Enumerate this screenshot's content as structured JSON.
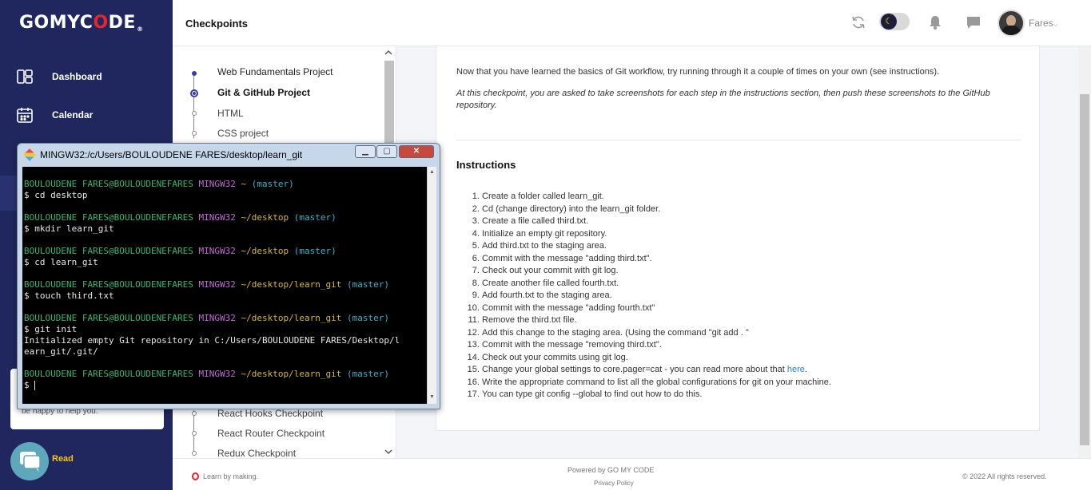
{
  "brand": {
    "logo_prefix": "GOMYC",
    "logo_o": "O",
    "logo_suffix": "DE",
    "reg": "®"
  },
  "sidebar": {
    "items": [
      {
        "label": "Dashboard",
        "icon": "dashboard-icon"
      },
      {
        "label": "Calendar",
        "icon": "calendar-icon"
      }
    ],
    "help_text": "be happy to help you.",
    "read_label": "Read"
  },
  "header": {
    "title": "Checkpoints",
    "user_name": "Fares",
    "icons": [
      "refresh-icon",
      "dark-mode-toggle",
      "bell-icon",
      "chat-icon"
    ]
  },
  "checkpoints": {
    "items": [
      "Web Fundamentals Project",
      "Git & GitHub Project",
      "HTML",
      "CSS project"
    ],
    "lower_items": [
      "React Hooks Checkpoint",
      "React Router Checkpoint",
      "Redux Checkpoint"
    ]
  },
  "main": {
    "intro": "Now that you have learned the basics of Git workflow, try running through it a couple of times on your own (see instructions).",
    "intro2": "At this checkpoint, you are asked to take screenshots for each step in the instructions section, then push these screenshots to the GitHub repository.",
    "instructions_title": "Instructions",
    "steps": [
      "Create a folder called learn_git.",
      "Cd (change directory) into the learn_git folder.",
      "Create a file called third.txt.",
      "Initialize an empty git repository.",
      "Add third.txt to the staging area.",
      "Commit with the message \"adding third.txt\".",
      "Check out your commit with git log.",
      "Create another file called fourth.txt.",
      "Add fourth.txt to the staging area.",
      "Commit with the message \"adding fourth.txt\"",
      "Remove the third.txt file.",
      "Add this change to the staging area. (Using the command \"git add . \"",
      "Commit with the message \"removing third.txt\".",
      "Check out your commits using git log.",
      "Change your global settings to core.pager=cat - you can read more about that ",
      "Write the appropriate command to list all the global configurations for git on your machine.",
      "You can type git config --global to find out how to do this."
    ],
    "step15_link": "here",
    "step15_suffix": "."
  },
  "footer": {
    "slogan": "Learn by making.",
    "powered": "Powered by GO MY CODE",
    "privacy": "Privacy Policy",
    "copyright": "© 2022 All rights reserved."
  },
  "terminal": {
    "title": "MINGW32:/c/Users/BOULOUDENE FARES/desktop/learn_git",
    "user_host": "BOULOUDENE FARES@BOULOUDENEFARES",
    "shell": "MINGW32",
    "branch": "(master)",
    "blocks": [
      {
        "path": "~",
        "command": "$ cd desktop",
        "output": ""
      },
      {
        "path": "~/desktop",
        "command": "$ mkdir learn_git",
        "output": ""
      },
      {
        "path": "~/desktop",
        "command": "$ cd learn_git",
        "output": ""
      },
      {
        "path": "~/desktop/learn_git",
        "command": "$ touch third.txt",
        "output": ""
      },
      {
        "path": "~/desktop/learn_git",
        "command": "$ git init",
        "output": "Initialized empty Git repository in C:/Users/BOULOUDENE FARES/Desktop/l\nearn_git/.git/"
      },
      {
        "path": "~/desktop/learn_git",
        "command": "$ ",
        "output": ""
      }
    ],
    "buttons": {
      "minimize": "▁",
      "maximize": "▢",
      "close": "✕"
    }
  }
}
